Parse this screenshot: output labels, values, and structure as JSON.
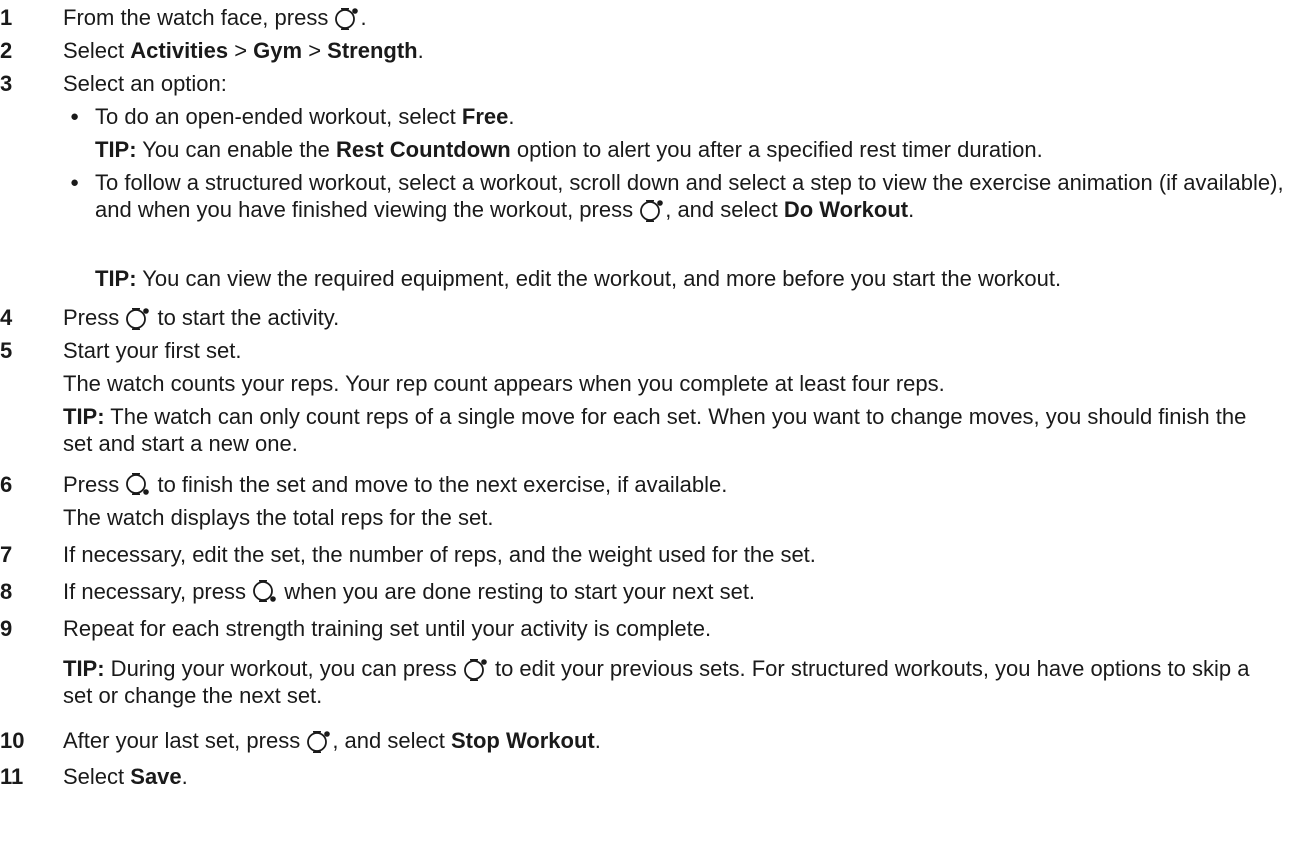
{
  "steps": [
    {
      "num": "1",
      "pre": "From the watch face, press ",
      "post": "."
    },
    {
      "num": "2",
      "t1": "Select ",
      "b1": "Activities",
      "t2": " > ",
      "b2": "Gym",
      "t3": " > ",
      "b3": "Strength",
      "t4": "."
    },
    {
      "num": "3",
      "text": "Select an option:"
    },
    {
      "num": "4",
      "pre": "Press ",
      "post": " to start the activity."
    },
    {
      "num": "5",
      "text": "Start your first set."
    },
    {
      "num": "6",
      "pre": "Press ",
      "post": " to finish the set and move to the next exercise, if available."
    },
    {
      "num": "7",
      "text": "If necessary, edit the set, the number of reps, and the weight used for the set."
    },
    {
      "num": "8",
      "pre": "If necessary, press ",
      "post": " when you are done resting to start your next set."
    },
    {
      "num": "9",
      "text": "Repeat for each strength training set until your activity is complete."
    },
    {
      "num": "10",
      "pre": "After your last set, press ",
      "mid": ", and select ",
      "bold": "Stop Workout",
      "post": "."
    },
    {
      "num": "11",
      "pre": "Select ",
      "bold": "Save",
      "post": "."
    }
  ],
  "options": {
    "free": {
      "pre": "To do an open-ended workout, select ",
      "bold": "Free",
      "post": "."
    },
    "free_tip": {
      "label": "TIP:",
      "pre": " You can enable the ",
      "bold": "Rest Countdown",
      "post": " option to alert you after a specified rest timer duration."
    },
    "structured": {
      "pre": "To follow a structured workout, select a workout, scroll down and select a step to view the exercise animation (if available), and when you have finished viewing the workout, press ",
      "mid": ", and select ",
      "bold": "Do Workout",
      "post": "."
    },
    "structured_tip": {
      "label": "TIP:",
      "text": " You can view the required equipment, edit the workout, and more before you start the workout."
    }
  },
  "step5_result": "The watch counts your reps. Your rep count appears when you complete at least four reps.",
  "step5_tip": {
    "label": "TIP:",
    "text": " The watch can only count reps of a single move for each set. When you want to change moves, you should finish the set and start a new one."
  },
  "step6_result": "The watch displays the total reps for the set.",
  "step9_tip": {
    "label": "TIP:",
    "pre": " During your workout, you can press ",
    "post": " to edit your previous sets. For structured workouts, you have options to skip a set or change the next set."
  },
  "icons": {
    "top_button": "watch-top-button-icon",
    "bottom_button": "watch-bottom-button-icon"
  }
}
